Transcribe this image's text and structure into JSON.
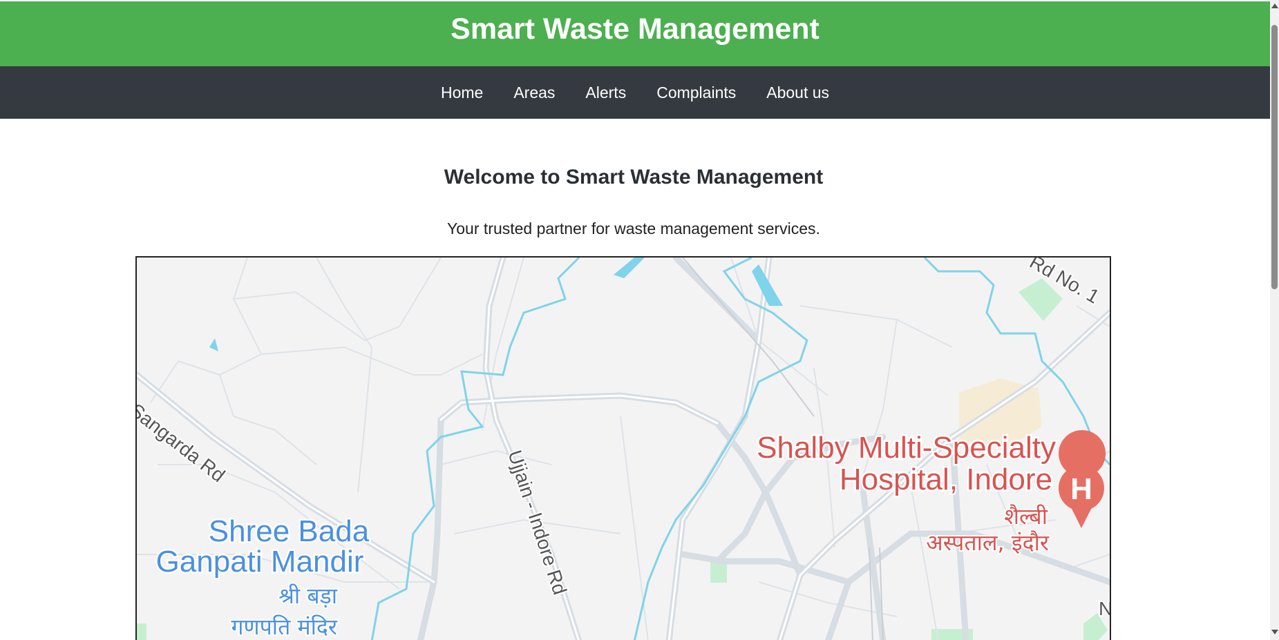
{
  "header": {
    "title": "Smart Waste Management"
  },
  "nav": {
    "items": [
      {
        "label": "Home"
      },
      {
        "label": "Areas"
      },
      {
        "label": "Alerts"
      },
      {
        "label": "Complaints"
      },
      {
        "label": "About us"
      }
    ]
  },
  "main": {
    "heading": "Welcome to Smart Waste Management",
    "tagline": "Your trusted partner for waste management services."
  },
  "map": {
    "labels": {
      "road_top": "Rd No. 1",
      "road_left": "Sangarda Rd",
      "road_center": "Ujjain - Indore Rd",
      "temple_en_1": "Shree Bada",
      "temple_en_2": "Ganpati Mandir",
      "temple_hi_1": "श्री बड़ा",
      "temple_hi_2": "गणपति मंदिर",
      "hospital_en_1": "Shalby Multi-Specialty",
      "hospital_en_2": "Hospital, Indore",
      "hospital_hi_1": "शैल्बी",
      "hospital_hi_2": "अस्पताल, इंदौर",
      "edge_letter": "N"
    },
    "icons": {
      "hospital_marker": "hospital-marker-icon",
      "marker_letter": "H"
    },
    "colors": {
      "background": "#f4f3f3",
      "road": "#d6dde3",
      "river": "#7fd3ea",
      "park": "#c6efd2",
      "poi_blue": "#4a90e2",
      "poi_red": "#d9534f",
      "marker": "#e66f63"
    }
  }
}
